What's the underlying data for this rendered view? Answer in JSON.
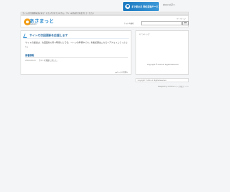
{
  "topbar": {
    "text": "サイトの次回更新を過去する？ まだ入力されていません。 サイトの名前などを設定してください"
  },
  "banner": {
    "text": "まで使える 単位変換サービス"
  },
  "side_link": "あなたの声へ",
  "header": {
    "logo_text": "あさまっと",
    "logo_sub": "asamatto",
    "search_label": "サイト内検索",
    "search_placeholder": "",
    "search_button": "検索",
    "link": "サイトマップ"
  },
  "main": {
    "title": "サイトの次回更新を応援します",
    "body": "サイトの運営は、次回更新を待つ時間にどうぞ。ページの準備中です。新着記事はこちらへアクセスしてください。",
    "news_head": "新着情報",
    "news": [
      {
        "date": "2009.08.18",
        "text": "サイトを開設しました。"
      }
    ],
    "page_top": "▲ページの先頭へ"
  },
  "sidebar": {
    "title": "ページトップ",
    "text": "Copyright © 2014 All Rights Reserved."
  },
  "footer": {
    "copyright": "Copyright © 2014 All Rights Reserved.",
    "powered": "Designed by CC BY-SA ページ作成 サーバー"
  }
}
